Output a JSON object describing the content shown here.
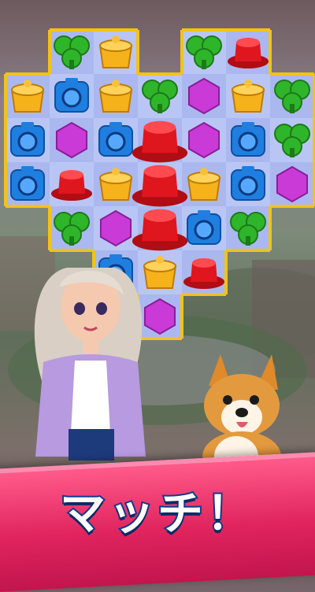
{
  "banner": {
    "text": "マッチ！"
  },
  "board": {
    "rows": [
      [
        "",
        "clover",
        "cake",
        "",
        "clover",
        "hat",
        ""
      ],
      [
        "cake",
        "camera",
        "cake",
        "clover",
        "gem",
        "cake",
        "clover"
      ],
      [
        "camera",
        "gem",
        "camera",
        "hat",
        "gem",
        "camera",
        "clover"
      ],
      [
        "camera",
        "hat",
        "cake",
        "hat",
        "cake",
        "camera",
        "gem"
      ],
      [
        "",
        "clover",
        "gem",
        "hat",
        "camera",
        "clover",
        ""
      ],
      [
        "",
        "",
        "camera",
        "cake",
        "hat",
        "",
        ""
      ],
      [
        "",
        "",
        "",
        "gem",
        "",
        "",
        ""
      ]
    ],
    "highlight_column": 3
  },
  "characters": [
    {
      "name": "girl-character"
    },
    {
      "name": "corgi-dog-character"
    }
  ],
  "colors": {
    "clover": "#2fb52a",
    "cake": "#f5b21a",
    "camera": "#1f7fe0",
    "gem": "#c93ad6",
    "hat": "#e0161e",
    "board_outline": "#f2c21a",
    "banner": "#e0245e"
  }
}
